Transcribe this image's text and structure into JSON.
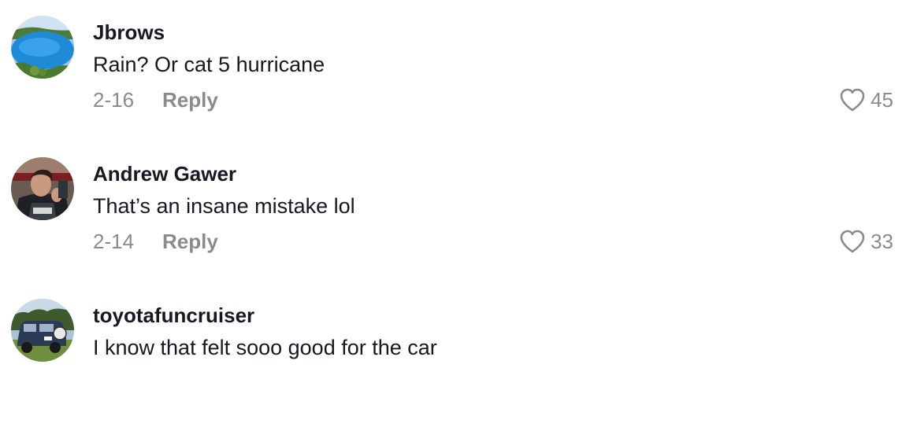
{
  "comments": [
    {
      "username": "Jbrows",
      "text": "Rain? Or cat 5 hurricane",
      "date": "2-16",
      "reply_label": "Reply",
      "likes": "45"
    },
    {
      "username": "Andrew Gawer",
      "text": "That’s an insane mistake lol",
      "date": "2-14",
      "reply_label": "Reply",
      "likes": "33"
    },
    {
      "username": "toyotafuncruiser",
      "text": "I know that felt sooo good for the car"
    }
  ],
  "colors": {
    "text_primary": "#161823",
    "text_secondary": "#8a8b91",
    "background": "#ffffff"
  },
  "icons": {
    "like": "heart-outline-icon"
  }
}
